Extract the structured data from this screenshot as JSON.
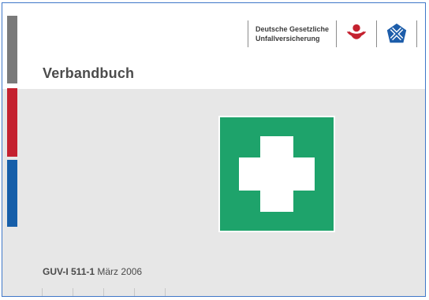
{
  "header": {
    "org_line1": "Deutsche Gesetzliche",
    "org_line2": "Unfallversicherung"
  },
  "title": "Verbandbuch",
  "document": {
    "code": "GUV-I 511-1",
    "date": "März 2006"
  },
  "colors": {
    "side_gray": "#7a7a7a",
    "side_red": "#c4212f",
    "side_blue": "#165ea9",
    "sign_green": "#1ea36b",
    "frame_blue": "#3f77c8",
    "background_gray": "#e7e7e7"
  },
  "icons": {
    "logo_left": "red-eagle-shield-icon",
    "logo_right": "blue-x-emblem-icon",
    "sign": "first-aid-cross-icon"
  }
}
